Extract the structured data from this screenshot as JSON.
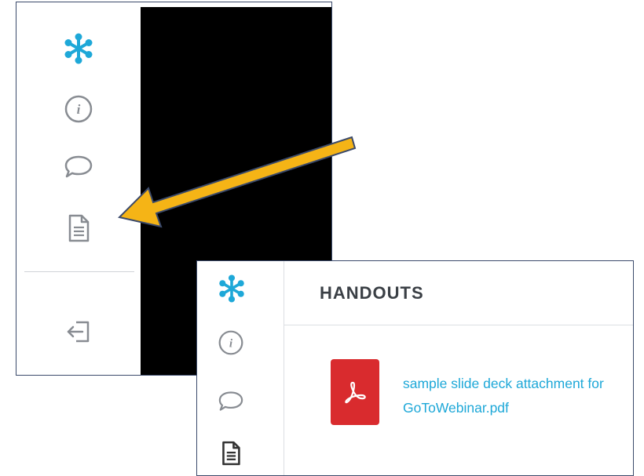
{
  "colors": {
    "accent": "#1ea8d8",
    "icon_gray": "#888c92",
    "icon_dark": "#333333",
    "arrow_fill": "#f5b416",
    "arrow_outline": "#3b4a6b",
    "pdf_red": "#d92b2e"
  },
  "screenshot_top": {
    "rail_icons": [
      "goto-logo-icon",
      "info-icon",
      "chat-bubble-icon",
      "document-icon",
      "exit-icon"
    ]
  },
  "screenshot_bottom": {
    "rail_icons": [
      "goto-logo-icon",
      "info-icon",
      "chat-bubble-icon",
      "document-icon"
    ],
    "panel_title": "HANDOUTS",
    "handouts": [
      {
        "name": "sample slide deck attachment for GoToWebinar.pdf",
        "icon": "pdf-icon"
      }
    ]
  }
}
